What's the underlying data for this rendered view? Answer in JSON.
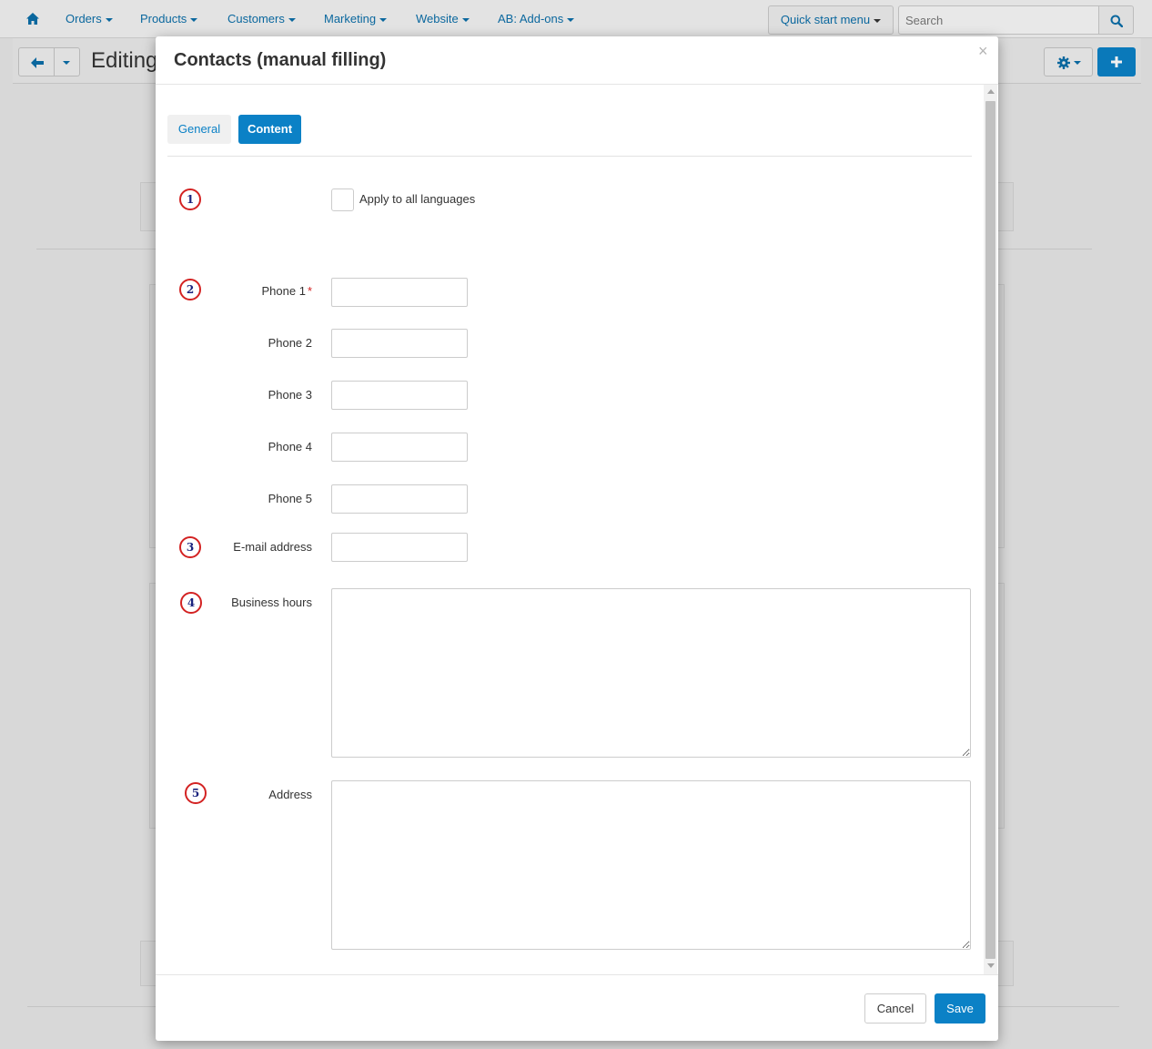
{
  "topnav": {
    "items": [
      {
        "label": "Orders"
      },
      {
        "label": "Products"
      },
      {
        "label": "Customers"
      },
      {
        "label": "Marketing"
      },
      {
        "label": "Website"
      },
      {
        "label": "AB: Add-ons"
      }
    ],
    "quick_start_label": "Quick start menu",
    "search_placeholder": "Search",
    "search_value": ""
  },
  "page": {
    "title": "Editing"
  },
  "modal": {
    "title": "Contacts (manual filling)",
    "close_glyph": "×",
    "tabs": [
      {
        "label": "General",
        "active": false
      },
      {
        "label": "Content",
        "active": true
      }
    ],
    "markers": [
      "1",
      "2",
      "3",
      "4",
      "5"
    ],
    "apply_all_languages": {
      "label": "Apply to all languages",
      "checked": false
    },
    "fields": {
      "phone1": {
        "label": "Phone 1",
        "required_mark": "*",
        "value": ""
      },
      "phone2": {
        "label": "Phone 2",
        "value": ""
      },
      "phone3": {
        "label": "Phone 3",
        "value": ""
      },
      "phone4": {
        "label": "Phone 4",
        "value": ""
      },
      "phone5": {
        "label": "Phone 5",
        "value": ""
      },
      "email": {
        "label": "E-mail address",
        "value": ""
      },
      "business_hours": {
        "label": "Business hours",
        "value": ""
      },
      "address": {
        "label": "Address",
        "value": ""
      }
    },
    "footer": {
      "cancel_label": "Cancel",
      "save_label": "Save"
    }
  },
  "colors": {
    "primary": "#0b81c6",
    "link": "#0b6ea8",
    "marker_ring": "#d32222",
    "marker_number": "#1a237e"
  },
  "icons": [
    "home-icon",
    "caret-down-icon",
    "search-icon",
    "arrow-left-icon",
    "gear-icon",
    "plus-icon",
    "close-icon"
  ]
}
